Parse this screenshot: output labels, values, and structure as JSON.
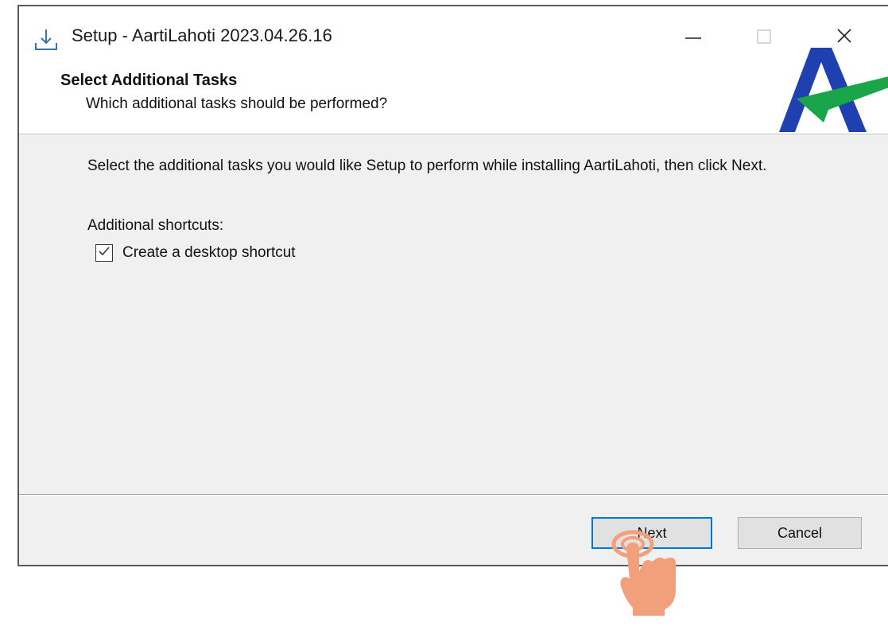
{
  "window": {
    "title": "Setup - AartiLahoti 2023.04.26.16",
    "controls": {
      "minimize_icon": "minimize-icon",
      "maximize_icon": "maximize-icon",
      "close_icon": "close-icon"
    }
  },
  "header": {
    "title": "Select Additional Tasks",
    "subtitle": "Which additional tasks should be performed?",
    "logo_icon": "aartilahoti-logo"
  },
  "content": {
    "description": "Select the additional tasks you would like Setup to perform while installing AartiLahoti, then click Next.",
    "shortcuts_label": "Additional shortcuts:",
    "tasks": [
      {
        "label": "Create a desktop shortcut",
        "checked": true
      }
    ]
  },
  "footer": {
    "next_label": "Next",
    "cancel_label": "Cancel"
  },
  "overlay": {
    "pointer_icon": "tap-hand-icon"
  },
  "colors": {
    "accent_blue": "#0078d7",
    "logo_blue": "#1e40b0",
    "logo_green": "#1aa54a",
    "hand_skin": "#f2a07b"
  }
}
